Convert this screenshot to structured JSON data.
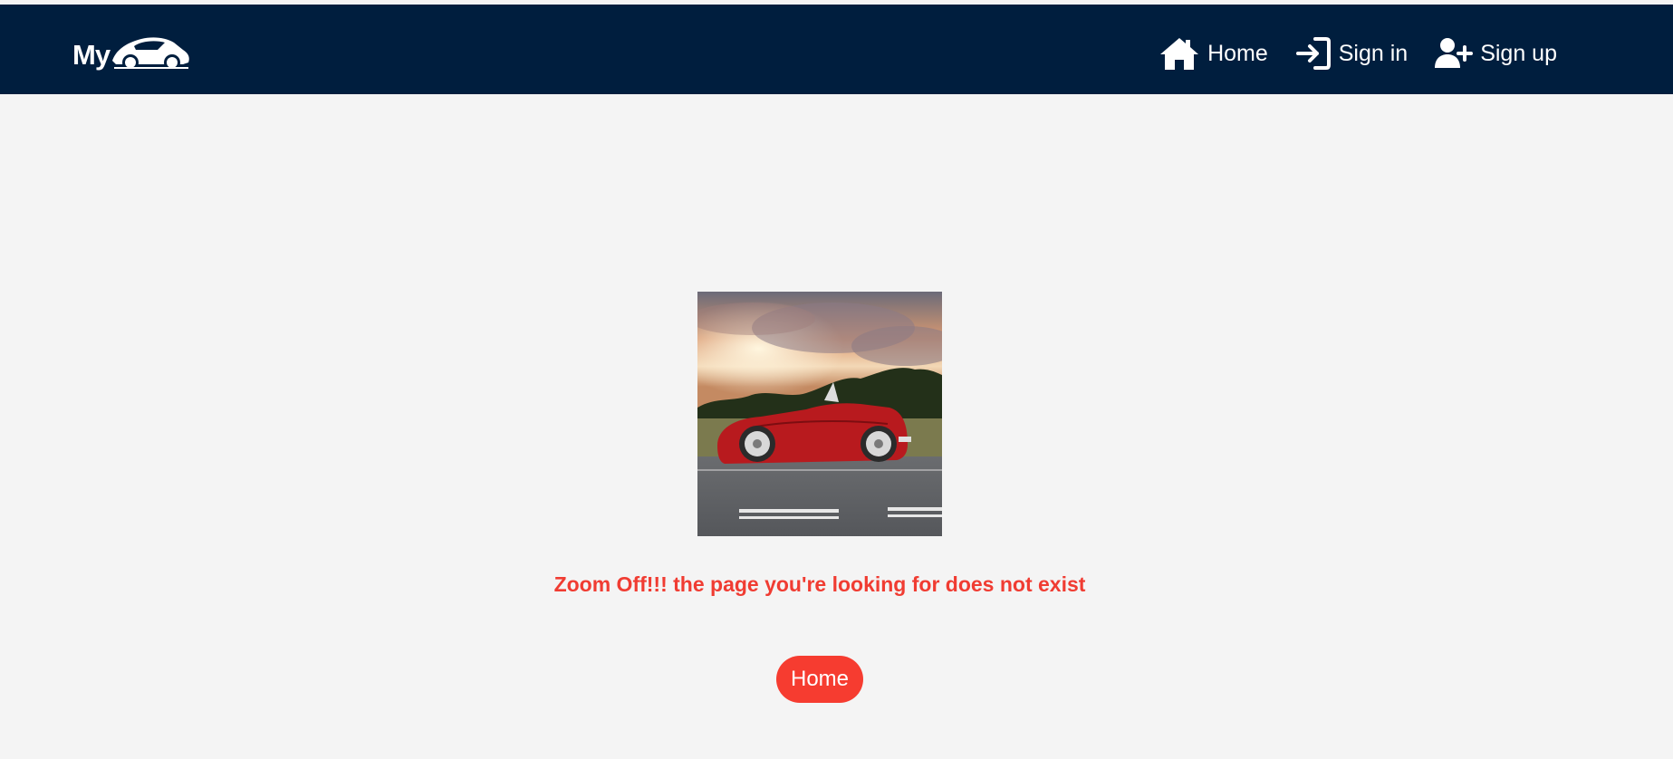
{
  "header": {
    "logo_text": "My",
    "logo_icon": "car-logo-icon",
    "nav": [
      {
        "label": "Home",
        "icon": "home-icon"
      },
      {
        "label": "Sign in",
        "icon": "sign-in-icon"
      },
      {
        "label": "Sign up",
        "icon": "user-plus-icon"
      }
    ]
  },
  "main": {
    "image_subject": "red vintage convertible car at sunset",
    "message": "Zoom Off!!! the page you're looking for does not exist",
    "home_button_label": "Home"
  },
  "colors": {
    "navbar_bg": "#001e3e",
    "page_bg": "#f4f4f4",
    "accent_red": "#f63c30",
    "message_red": "#f03c32"
  }
}
